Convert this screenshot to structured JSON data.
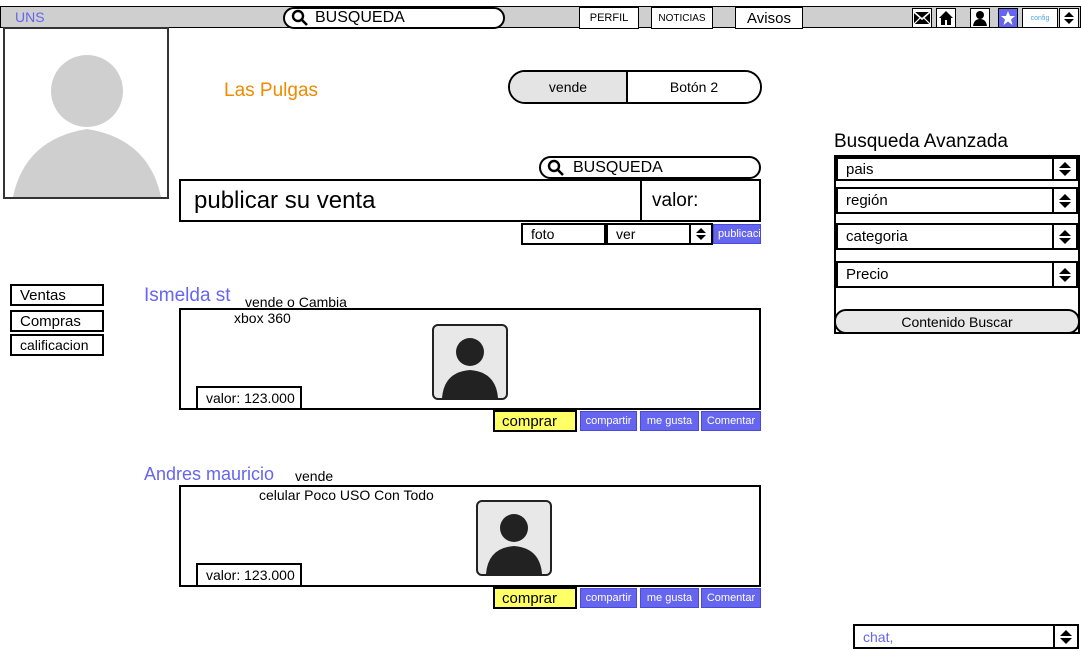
{
  "topbar": {
    "logo": "UNS",
    "search_label": "BUSQUEDA",
    "perfil": "PERFIL",
    "noticias": "NOTICIAS",
    "avisos": "Avisos",
    "config": "config"
  },
  "page": {
    "title": "Las Pulgas",
    "segment": [
      "vende",
      "Botón 2"
    ],
    "search_label": "BUSQUEDA",
    "publish_placeholder": "publicar su venta",
    "valor_label": "valor:",
    "foto_label": "foto",
    "ver_label": "ver",
    "publicar_label": "publicaci"
  },
  "sidebar": {
    "items": [
      "Ventas",
      "Compras",
      "calificacion"
    ]
  },
  "posts": [
    {
      "user": "Ismelda st",
      "action": "vende o Cambia",
      "item": "xbox 360",
      "price": "valor: 123.000",
      "actions": {
        "comprar": "comprar",
        "compartir": "compartir",
        "megusta": "me gusta",
        "comentar": "Comentar"
      }
    },
    {
      "user": "Andres mauricio",
      "action": "vende",
      "item": "celular Poco USO Con Todo",
      "price": "valor: 123.000",
      "actions": {
        "comprar": "comprar",
        "compartir": "compartir",
        "megusta": "me gusta",
        "comentar": "Comentar"
      }
    }
  ],
  "advanced": {
    "title": "Busqueda Avanzada",
    "filters": [
      "pais",
      "región",
      "categoria",
      "Precio"
    ],
    "button": "Contenido Buscar"
  },
  "chat": {
    "label": "chat,"
  },
  "colors": {
    "accent": "#6565f0",
    "orange": "#f08a00",
    "yellow": "#ffff66"
  }
}
